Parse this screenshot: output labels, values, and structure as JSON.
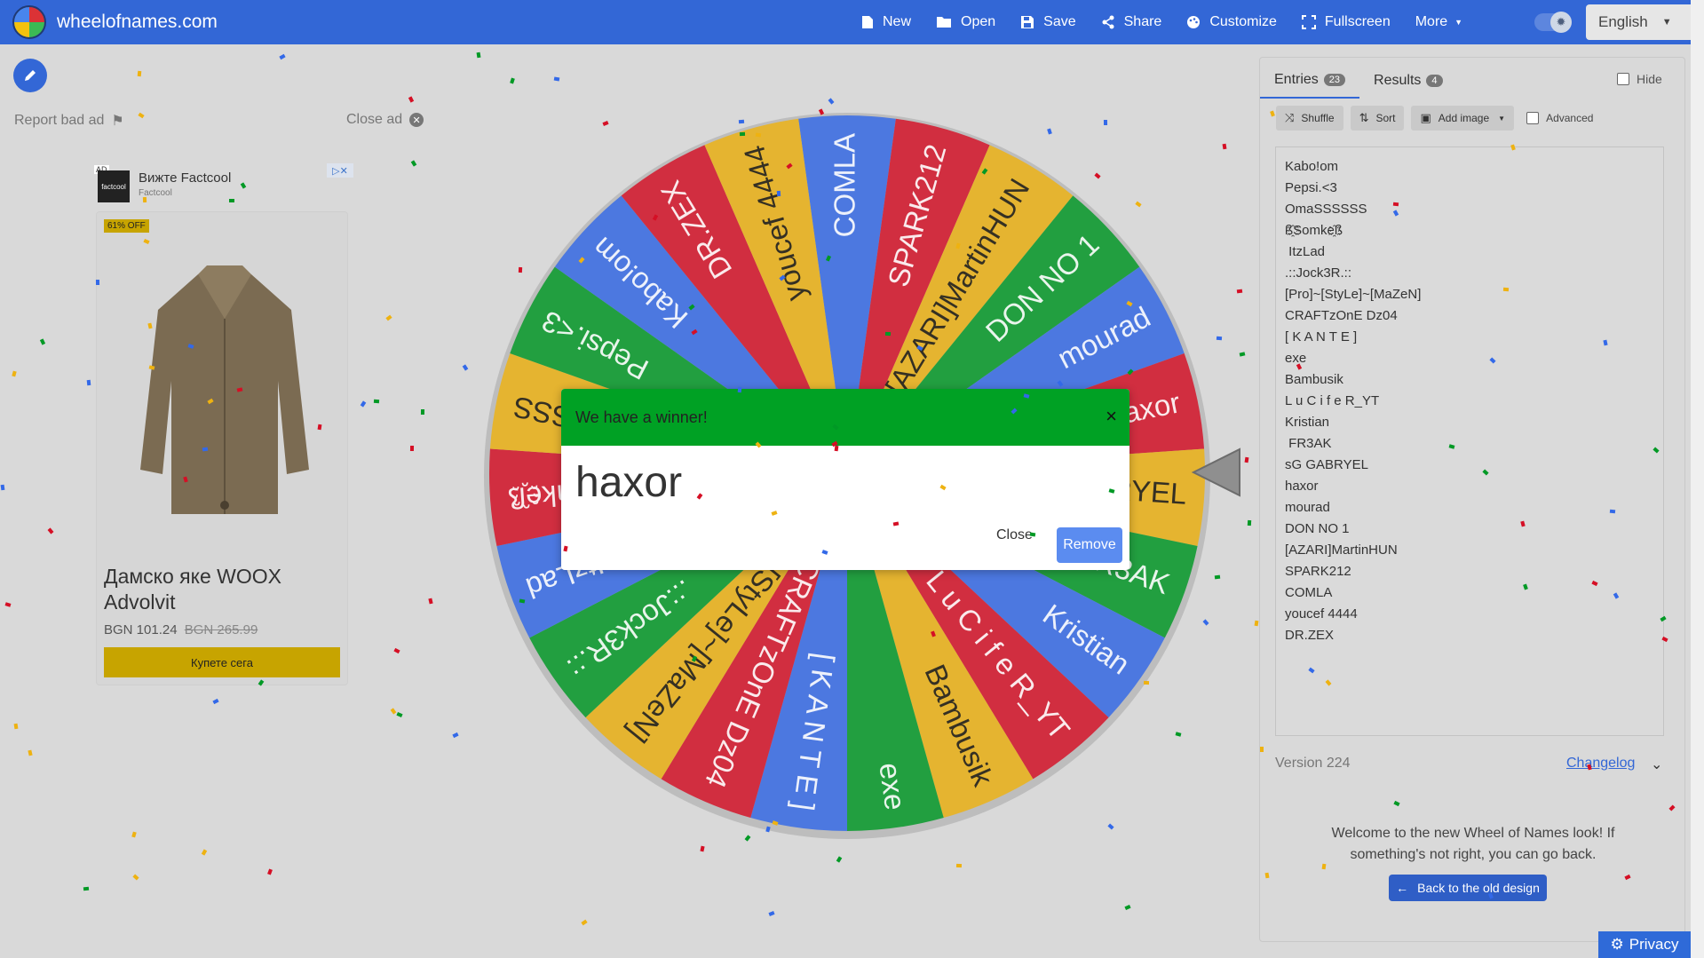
{
  "header": {
    "brand": "wheelofnames.com",
    "nav": [
      {
        "label": "New",
        "icon": "file-icon"
      },
      {
        "label": "Open",
        "icon": "folder-icon"
      },
      {
        "label": "Save",
        "icon": "save-icon"
      },
      {
        "label": "Share",
        "icon": "share-icon"
      },
      {
        "label": "Customize",
        "icon": "palette-icon"
      },
      {
        "label": "Fullscreen",
        "icon": "fullscreen-icon"
      },
      {
        "label": "More",
        "icon": "chevron-down-icon"
      }
    ],
    "language": "English"
  },
  "ad": {
    "report_label": "Report bad ad",
    "close_label": "Close ad",
    "label": "AD",
    "brand": "Вижте Factcool",
    "brand_sub": "Factcool",
    "logo_text": "factcool",
    "badge": "61% OFF",
    "title": "Дамско яке WOOX Advolvit",
    "price": "BGN 101.24",
    "old_price": "BGN 265.99",
    "cta": "Купете сега"
  },
  "wheel": {
    "colors": [
      "#3369e8",
      "#d50f25",
      "#eeb211",
      "#009925"
    ],
    "segments": [
      "COMLA",
      "SPARK212",
      "[AZARI]MartinHUN",
      "DON NO 1",
      "mourad",
      "haxor",
      "sG GABRYEL",
      "FR3AK",
      "Kristian",
      "L u C i f e R_YT",
      "Bambusik",
      "exe",
      "[ K A N T E ]",
      "CRAFTzOnE Dz04",
      "[Pro]~[StyLe]~[MaZeN]",
      ".::Jock3R.::",
      "ItzLad",
      "ß҈Somke҈ß",
      "OmaSSSSSS",
      "Pepsi.<3",
      "Kabo!om",
      "DR.ZEX",
      "youcef 4444"
    ]
  },
  "dialog": {
    "title": "We have a winner!",
    "winner": "haxor",
    "close_label": "Close",
    "remove_label": "Remove"
  },
  "panel": {
    "tabs": [
      {
        "label": "Entries",
        "count": "23"
      },
      {
        "label": "Results",
        "count": "4"
      }
    ],
    "hide_label": "Hide",
    "toolbar": {
      "shuffle": "Shuffle",
      "sort": "Sort",
      "add_image": "Add image",
      "advanced": "Advanced"
    },
    "entries": [
      "Kabo!om",
      "Pepsi.<3",
      "OmaSSSSSS",
      "ß҈Somke҈ß",
      " ItzLad",
      ".::Jock3R.::",
      "[Pro]~[StyLe]~[MaZeN]",
      "CRAFTzOnE Dz04",
      "[ K A N T E ]",
      "exe",
      "Bambusik",
      "L u C i f e R_YT",
      "Kristian",
      " FR3AK",
      "sG GABRYEL",
      "haxor",
      "mourad",
      "DON NO 1",
      "[AZARI]MartinHUN",
      "SPARK212",
      "COMLA",
      "youcef 4444",
      "DR.ZEX"
    ],
    "version": "Version 224",
    "changelog": "Changelog",
    "welcome": "Welcome to the new Wheel of Names look! If something's not right, you can go back.",
    "old_design": "Back to the old design"
  },
  "privacy": "Privacy"
}
